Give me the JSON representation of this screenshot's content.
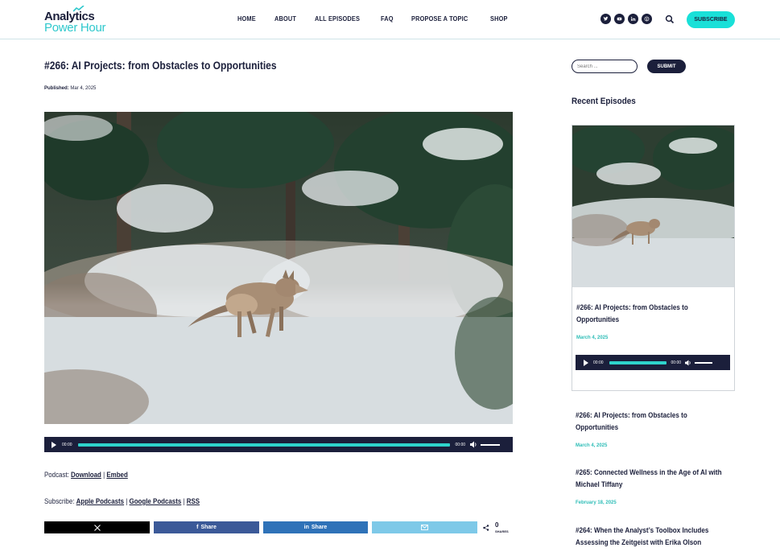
{
  "site": {
    "logo_line1": "Analytics",
    "logo_line2": "Power Hour",
    "brand_color": "#19e0d8",
    "dark_color": "#1b1f3b"
  },
  "nav": {
    "items": [
      "HOME",
      "ABOUT",
      "ALL EPISODES",
      "FAQ",
      "PROPOSE A TOPIC",
      "SHOP"
    ]
  },
  "header": {
    "social_icons": [
      "twitter-icon",
      "youtube-icon",
      "linkedin-icon",
      "apple-podcasts-icon"
    ],
    "subscribe_label": "SUBSCRIBE"
  },
  "post": {
    "title": "#266: AI Projects: from Obstacles to Opportunities",
    "published_label": "Published:",
    "published_date": "Mar 4, 2025"
  },
  "player": {
    "current_time": "00:00",
    "duration": "00:00"
  },
  "podcast": {
    "label": "Podcast:",
    "download": "Download",
    "separator": "|",
    "embed": "Embed"
  },
  "subscribe": {
    "label": "Subscribe:",
    "apple": "Apple Podcasts",
    "google": "Google Podcasts",
    "rss": "RSS"
  },
  "share": {
    "buttons": [
      {
        "name": "x",
        "label": "",
        "color": "#000000"
      },
      {
        "name": "facebook",
        "label": "Share",
        "color": "#3b5998"
      },
      {
        "name": "linkedin",
        "label": "Share",
        "color": "#2f72b8"
      },
      {
        "name": "email",
        "label": "",
        "color": "#7ec9e8"
      }
    ],
    "count": "0",
    "count_label": "SHARES"
  },
  "sidebar": {
    "search_placeholder": "Search ...",
    "submit_label": "SUBMIT",
    "recent_title": "Recent Episodes",
    "featured": {
      "title": "#266: AI Projects: from Obstacles to Opportunities",
      "date": "March 4, 2025"
    },
    "episodes": [
      {
        "title": "#266: AI Projects: from Obstacles to Opportunities",
        "date": "March 4, 2025"
      },
      {
        "title": "#265: Connected Wellness in the Age of AI with Michael Tiffany",
        "date": "February 18, 2025"
      },
      {
        "title": "#264: When the Analyst’s Toolbox Includes Assessing the Zeitgeist with Erika Olson",
        "date": ""
      }
    ]
  }
}
